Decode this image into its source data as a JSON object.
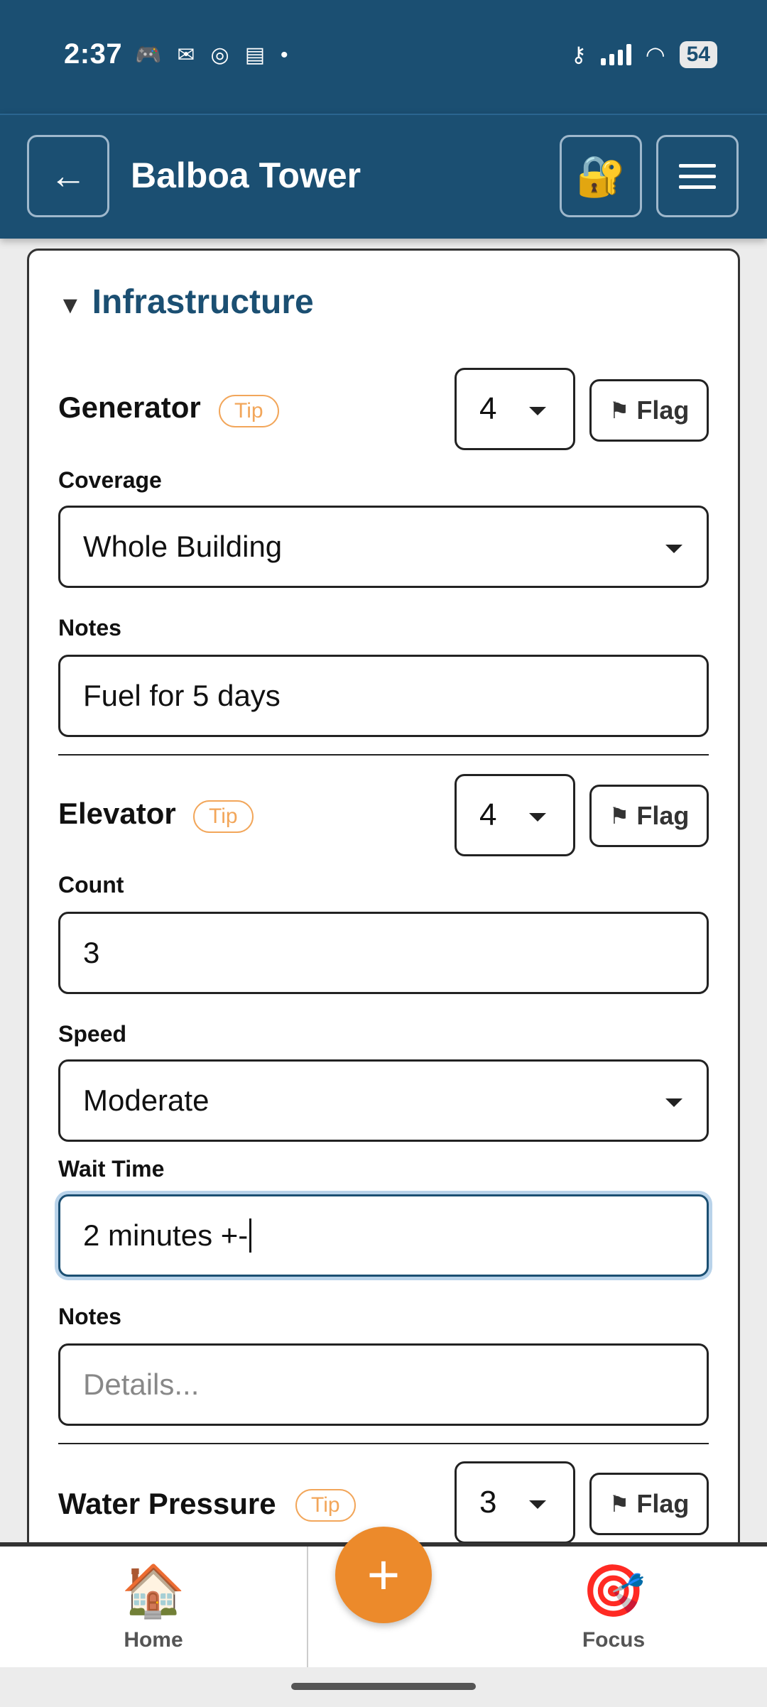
{
  "status_bar": {
    "time": "2:37",
    "battery": "54",
    "left_icons": [
      "game-controller-icon",
      "gmail-icon",
      "chrome-icon",
      "app-icon",
      "dot-icon"
    ],
    "right_icons": [
      "key-icon",
      "signal-icon",
      "wifi-icon",
      "battery-icon"
    ]
  },
  "header": {
    "back_icon": "←",
    "title": "Balboa Tower",
    "lock_icon": "🔐"
  },
  "section": {
    "toggle": "▼",
    "title": "Infrastructure"
  },
  "items": [
    {
      "title": "Generator",
      "tip": "Tip",
      "score": "4",
      "flag": "Flag",
      "fields": [
        {
          "label": "Coverage",
          "value": "Whole Building",
          "type": "select"
        },
        {
          "label": "Notes",
          "value": "Fuel for 5 days",
          "type": "text"
        }
      ]
    },
    {
      "title": "Elevator",
      "tip": "Tip",
      "score": "4",
      "flag": "Flag",
      "fields": [
        {
          "label": "Count",
          "value": "3",
          "type": "text"
        },
        {
          "label": "Speed",
          "value": "Moderate",
          "type": "select"
        },
        {
          "label": "Wait Time",
          "value": "2 minutes +-",
          "type": "text",
          "focused": true
        },
        {
          "label": "Notes",
          "placeholder": "Details...",
          "type": "text"
        }
      ]
    },
    {
      "title": "Water Pressure",
      "tip": "Tip",
      "score": "3",
      "flag": "Flag"
    }
  ],
  "bottom_nav": {
    "home": {
      "label": "Home",
      "icon": "🏠"
    },
    "add": {
      "icon": "+"
    },
    "focus": {
      "label": "Focus",
      "icon": "🎯"
    }
  },
  "colors": {
    "header_bg": "#1b4f72",
    "accent": "#ec8a2b",
    "tip": "#f2a65a"
  }
}
